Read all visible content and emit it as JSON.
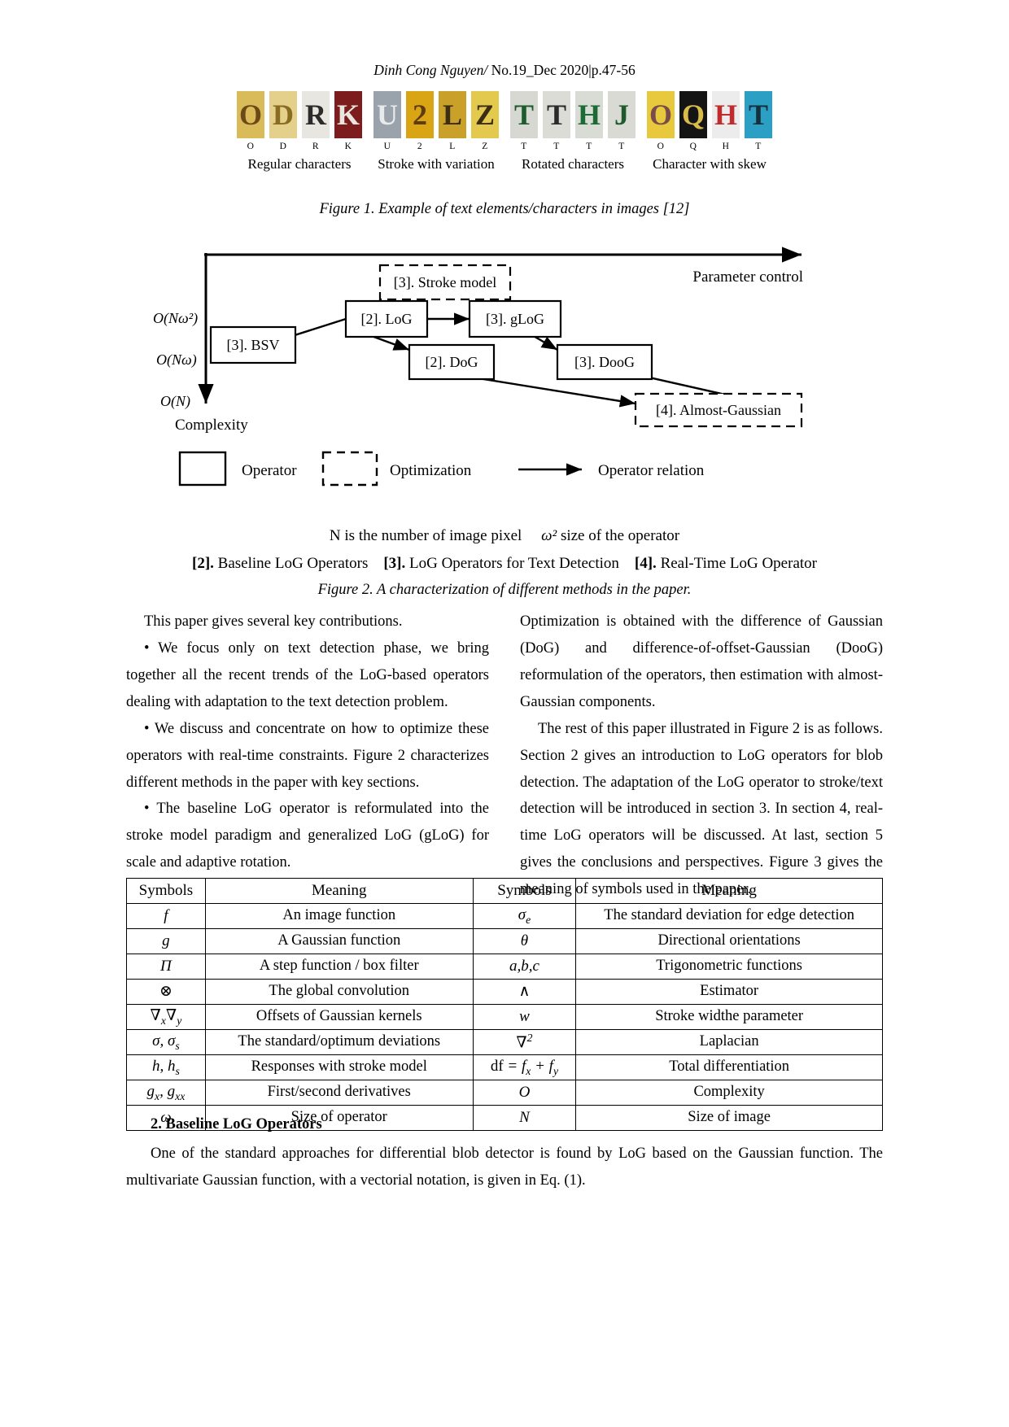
{
  "header": {
    "author": "Dinh Cong Nguyen/",
    "issue": "No.19_Dec 2020|p.47-56"
  },
  "figure1": {
    "caption": "Figure 1. Example of text elements/characters in images [12]",
    "groups": [
      {
        "label": "Regular characters",
        "chars": [
          {
            "glyph": "O",
            "label": "O",
            "bg": "#d9bb5a",
            "fg": "#6b4a18"
          },
          {
            "glyph": "D",
            "label": "D",
            "bg": "#e4cf8b",
            "fg": "#8a6b22"
          },
          {
            "glyph": "R",
            "label": "R",
            "bg": "#e8e6e0",
            "fg": "#2b2b2b"
          },
          {
            "glyph": "K",
            "label": "K",
            "bg": "#7c1c1c",
            "fg": "#e9e6df"
          }
        ]
      },
      {
        "label": "Stroke with variation",
        "chars": [
          {
            "glyph": "U",
            "label": "U",
            "bg": "#9aa3ab",
            "fg": "#e8eaec"
          },
          {
            "glyph": "2",
            "label": "2",
            "bg": "#d9a514",
            "fg": "#5e3a10"
          },
          {
            "glyph": "L",
            "label": "L",
            "bg": "#c9a02a",
            "fg": "#3a2d12"
          },
          {
            "glyph": "Z",
            "label": "Z",
            "bg": "#e3c94e",
            "fg": "#3a2d12"
          }
        ]
      },
      {
        "label": "Rotated characters",
        "chars": [
          {
            "glyph": "T",
            "label": "T",
            "bg": "#d8d8d2",
            "fg": "#1c5c2c"
          },
          {
            "glyph": "T",
            "label": "T",
            "bg": "#dcdcd6",
            "fg": "#2a2a2a"
          },
          {
            "glyph": "H",
            "label": "T",
            "bg": "#d8dcd4",
            "fg": "#1c6b34"
          },
          {
            "glyph": "J",
            "label": "T",
            "bg": "#dadad4",
            "fg": "#1c5c2c"
          }
        ]
      },
      {
        "label": "Character with skew",
        "chars": [
          {
            "glyph": "O",
            "label": "O",
            "bg": "#e8c83c",
            "fg": "#7a4b4b"
          },
          {
            "glyph": "Q",
            "label": "Q",
            "bg": "#141414",
            "fg": "#d9bb4a"
          },
          {
            "glyph": "H",
            "label": "H",
            "bg": "#ececec",
            "fg": "#c22b2b"
          },
          {
            "glyph": "T",
            "label": "T",
            "bg": "#2c9fc4",
            "fg": "#15303a"
          }
        ]
      }
    ]
  },
  "figure2": {
    "caption": "Figure 2. A characterization of different methods in the paper.",
    "axis": {
      "x_label": "Parameter control",
      "y_label": "Complexity",
      "ticks": [
        "O(Nω²)",
        "O(Nω)",
        "O(N)"
      ]
    },
    "nodes": {
      "bsv": "[3]. BSV",
      "log": "[2]. LoG",
      "glog": "[3]. gLoG",
      "dog": "[2]. DoG",
      "doog": "[3]. DooG",
      "stroke_model": "[3]. Stroke model",
      "almost_gaussian": "[4]. Almost-Gaussian"
    },
    "legend": {
      "operator": "Operator",
      "optimization": "Optimization",
      "relation": "Operator relation"
    },
    "note_left": "N is the number of image pixel",
    "note_right_sym": "ω²",
    "note_right": " size of the operator",
    "refs": [
      {
        "tag": "[2].",
        "text": " Baseline LoG Operators"
      },
      {
        "tag": "[3].",
        "text": " LoG Operators for Text Detection"
      },
      {
        "tag": "[4].",
        "text": " Real-Time LoG Operator"
      }
    ]
  },
  "body": {
    "left": [
      "This paper gives several key contributions.",
      "• We focus only on text detection phase, we bring together all the recent trends of the LoG-based operators dealing with adaptation to the text detection problem.",
      "• We discuss and concentrate on how to optimize these operators with real-time constraints. Figure 2 characterizes different methods in the paper with key sections.",
      "• The baseline LoG operator is reformulated into the stroke model paradigm and generalized LoG (gLoG) for scale and adaptive rotation."
    ],
    "right": [
      "Optimization is obtained with the difference of Gaussian (DoG) and difference-of-offset-Gaussian (DooG) reformulation of the operators, then estimation with almost-Gaussian components.",
      "The rest of this paper illustrated in Figure 2 is as follows. Section 2 gives an introduction to LoG operators for blob detection. The adaptation of the LoG operator to stroke/text detection will be introduced in section 3. In section 4, real-time LoG operators will be discussed. At last, section 5 gives the conclusions and perspectives. Figure 3 gives the meaning of symbols used in the paper."
    ]
  },
  "symbols_table": {
    "headers": {
      "symbols_left": "Symbols",
      "meaning_left": "Meaning",
      "symbols_right": "Symbols",
      "meaning_right": "Meaning"
    },
    "rows": [
      {
        "sym_l": "f",
        "mean_l": "An image function",
        "sym_r": "σe",
        "mean_r": "The standard deviation for edge detection"
      },
      {
        "sym_l": "g",
        "mean_l": "A Gaussian function",
        "sym_r": "θ",
        "mean_r": "Directional orientations"
      },
      {
        "sym_l": "Π",
        "mean_l": "A step function / box filter",
        "sym_r": "a,b,c",
        "mean_r": "Trigonometric functions"
      },
      {
        "sym_l": "⊗",
        "mean_l": "The global convolution",
        "sym_r": "∧",
        "mean_r": "Estimator"
      },
      {
        "sym_l": "∇x∇y",
        "mean_l": "Offsets of Gaussian kernels",
        "sym_r": "w",
        "mean_r": "Stroke widthe parameter"
      },
      {
        "sym_l": "σ, σs",
        "mean_l": "The standard/optimum deviations",
        "sym_r": "∇2",
        "mean_r": "Laplacian"
      },
      {
        "sym_l": "h, hs",
        "mean_l": "Responses with stroke model",
        "sym_r": "df = fx + fy",
        "mean_r": "Total differentiation"
      },
      {
        "sym_l": "gx, gxx",
        "mean_l": "First/second derivatives",
        "sym_r": "O",
        "mean_r": "Complexity"
      },
      {
        "sym_l": "ω",
        "mean_l": "Size of operator",
        "sym_r": "N",
        "mean_r": "Size of image"
      }
    ]
  },
  "section2": {
    "heading": "2. Baseline LoG Operators",
    "paragraph": "One of the standard approaches for differential blob detector is found by LoG based on the Gaussian function. The multivariate Gaussian function, with a vectorial notation, is given in Eq. (1)."
  }
}
